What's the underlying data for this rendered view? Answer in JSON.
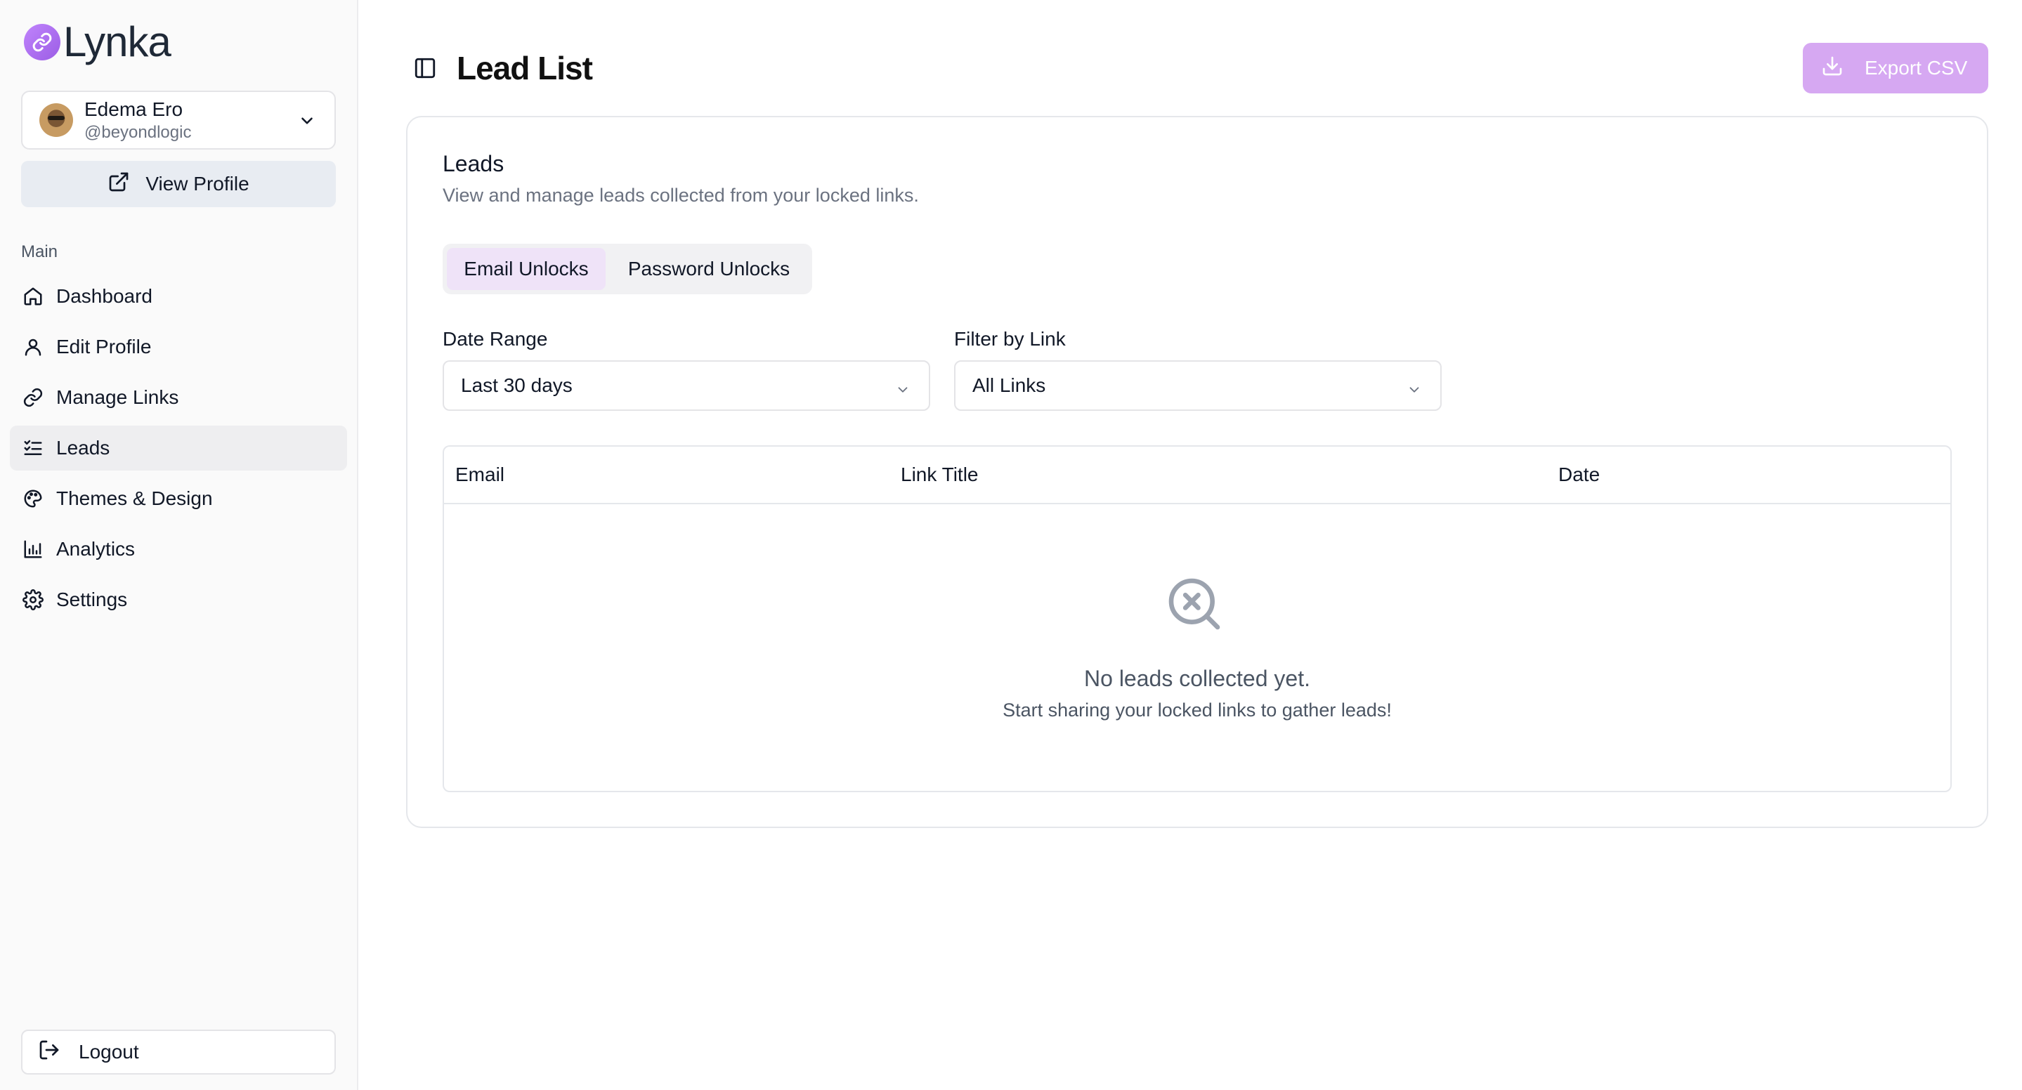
{
  "app": {
    "name": "Lynka",
    "accent": "#9b5de5"
  },
  "account": {
    "name": "Edema Ero",
    "handle": "@beyondlogic"
  },
  "sidebar": {
    "view_profile_label": "View Profile",
    "section_label": "Main",
    "items": [
      {
        "label": "Dashboard",
        "icon": "home-icon",
        "active": false
      },
      {
        "label": "Edit Profile",
        "icon": "user-icon",
        "active": false
      },
      {
        "label": "Manage Links",
        "icon": "link-icon",
        "active": false
      },
      {
        "label": "Leads",
        "icon": "list-check-icon",
        "active": true
      },
      {
        "label": "Themes & Design",
        "icon": "palette-icon",
        "active": false
      },
      {
        "label": "Analytics",
        "icon": "bar-chart-icon",
        "active": false
      },
      {
        "label": "Settings",
        "icon": "gear-icon",
        "active": false
      }
    ],
    "logout_label": "Logout"
  },
  "header": {
    "title": "Lead List",
    "export_label": "Export CSV"
  },
  "card": {
    "title": "Leads",
    "description": "View and manage leads collected from your locked links.",
    "tabs": [
      {
        "label": "Email Unlocks",
        "active": true
      },
      {
        "label": "Password Unlocks",
        "active": false
      }
    ],
    "filters": {
      "date_range": {
        "label": "Date Range",
        "value": "Last 30 days"
      },
      "link": {
        "label": "Filter by Link",
        "value": "All Links"
      }
    },
    "table": {
      "columns": [
        "Email",
        "Link Title",
        "Date"
      ],
      "empty_title": "No leads collected yet.",
      "empty_subtitle": "Start sharing your locked links to gather leads!"
    }
  }
}
